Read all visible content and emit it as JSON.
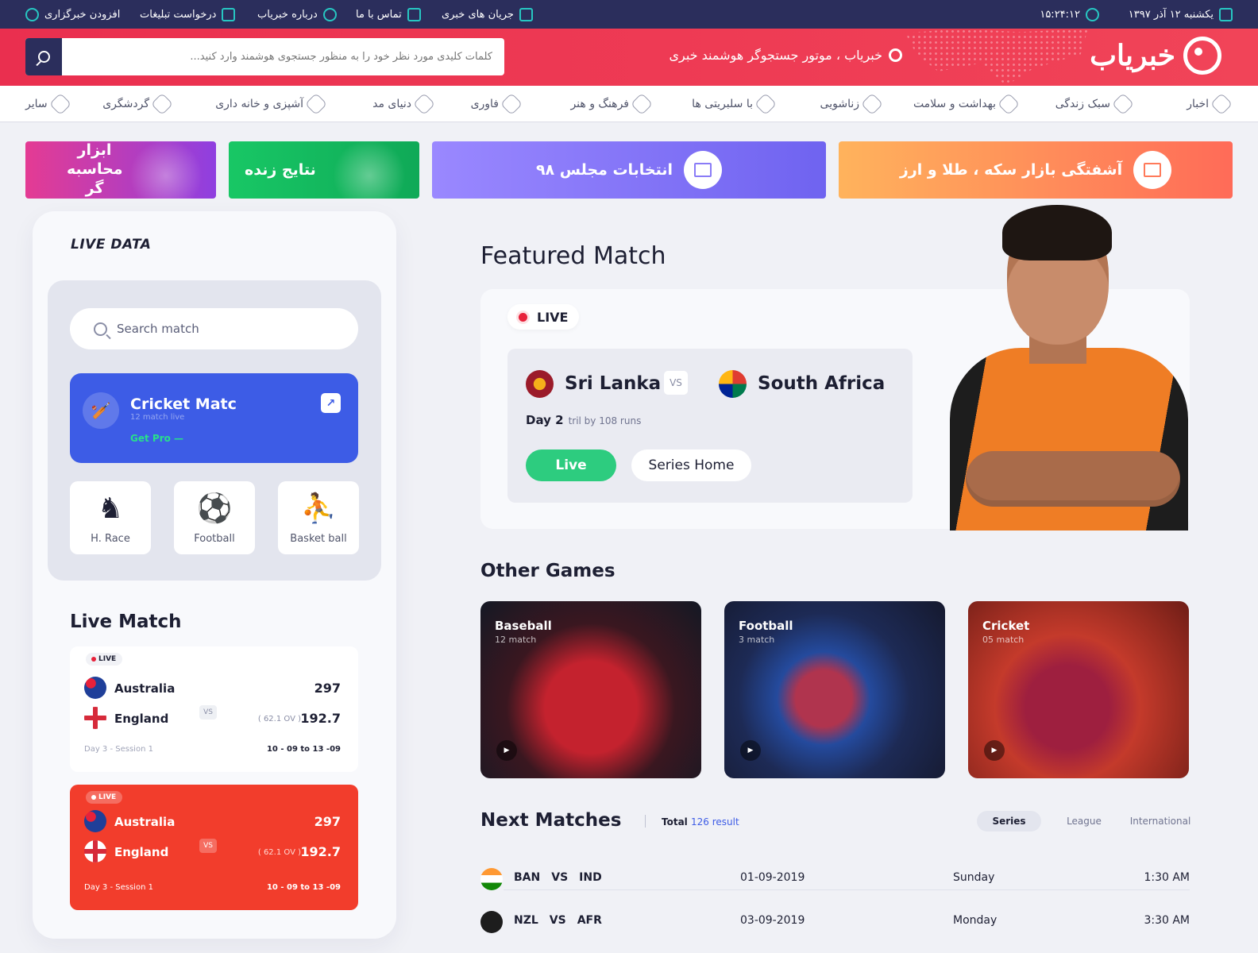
{
  "topbar": {
    "date": "یکشنبه ۱۲ آذر ۱۳۹۷",
    "time": "۱۵:۲۴:۱۲",
    "links": [
      "جریان های خبری",
      "تماس با ما",
      "درباره خبریاب",
      "درخواست تبلیغات",
      "افزودن خبرگزاری"
    ]
  },
  "header": {
    "brand": "خبریاب",
    "slogan": "خبریاب ، موتور جستجوگر هوشمند خبری",
    "search_placeholder": "کلمات کلیدی مورد نظر خود را به منظور جستجوی هوشمند وارد کنید..."
  },
  "nav": [
    "اخبار",
    "سبک زندگی",
    "بهداشت و سلامت",
    "زناشویی",
    "با سلبریتی ها",
    "فرهنگ و هنر",
    "فاوری",
    "دنیای مد",
    "آشپزی و خانه داری",
    "گردشگری",
    "سایر"
  ],
  "banners": [
    "آشفتگی بازار سکه ، طلا و ارز",
    "انتخابات مجلس ۹۸",
    "نتایج زنده",
    "ابزار محاسبه گر"
  ],
  "sidebar": {
    "title": "LIVE DATA",
    "search_placeholder": "Search match",
    "promo": {
      "title": "Cricket Matc",
      "subtitle": "12 match live",
      "cta": "Get Pro —"
    },
    "sports": [
      "H. Race",
      "Football",
      "Basket ball"
    ],
    "live_match_title": "Live Match",
    "matches": [
      {
        "tag": "LIVE",
        "team1": "Australia",
        "team2": "England",
        "score1": "297",
        "score2": "192.7",
        "overs": "( 62.1 OV )",
        "vs": "VS",
        "session": "Day 3 - Session 1",
        "dates": "10 - 09  to  13 -09"
      },
      {
        "tag": "LIVE",
        "team1": "Australia",
        "team2": "England",
        "score1": "297",
        "score2": "192.7",
        "overs": "( 62.1 OV )",
        "vs": "VS",
        "session": "Day 3 - Session 1",
        "dates": "10 - 09  to  13 -09"
      }
    ]
  },
  "featured": {
    "title": "Featured Match",
    "live": "LIVE",
    "team1": "Sri Lanka",
    "team2": "South Africa",
    "vs": "VS",
    "day": "Day 2",
    "day_note": "tril by 108 runs",
    "btn_live": "Live",
    "btn_series": "Series Home"
  },
  "other_games": {
    "title": "Other Games",
    "items": [
      {
        "name": "Baseball",
        "count": "12 match"
      },
      {
        "name": "Football",
        "count": "3 match"
      },
      {
        "name": "Cricket",
        "count": "05 match"
      }
    ]
  },
  "next_matches": {
    "title": "Next Matches",
    "total_label": "Total",
    "total_value": "126 result",
    "tabs": [
      "Series",
      "League",
      "International"
    ],
    "rows": [
      {
        "team1": "BAN",
        "vs": "VS",
        "team2": "IND",
        "date": "01-09-2019",
        "day": "Sunday",
        "time": "1:30  AM"
      },
      {
        "team1": "NZL",
        "vs": "VS",
        "team2": "AFR",
        "date": "03-09-2019",
        "day": "Monday",
        "time": "3:30  AM"
      }
    ]
  }
}
